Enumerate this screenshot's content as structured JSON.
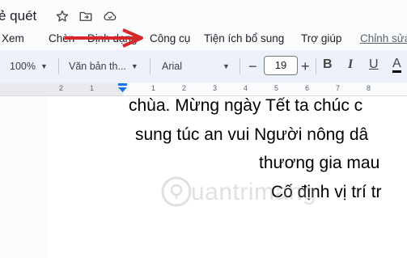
{
  "title_bar": {
    "doc_title": "ẻ quét",
    "icons": [
      "star-icon",
      "move-to-folder-icon",
      "cloud-status-icon"
    ]
  },
  "menu": {
    "items": [
      "Xem",
      "Chèn",
      "Định dạng",
      "Công cụ",
      "Tiện ích bổ sung",
      "Trợ giúp",
      "Chỉnh sửa"
    ]
  },
  "toolbar": {
    "zoom": "100%",
    "style": "Văn bản th...",
    "font": "Arial",
    "minus": "−",
    "font_size": "19",
    "plus": "+",
    "bold": "B",
    "italic": "I",
    "underline": "U",
    "text_color": "A"
  },
  "ruler": {
    "labels": [
      "2",
      "1",
      "1",
      "2",
      "3",
      "4",
      "5",
      "6",
      "7",
      "8"
    ]
  },
  "document": {
    "lines": [
      "chùa. Mừng ngày Tết ta chúc c",
      "sung túc an vui Người nông dâ",
      "thương gia mau",
      "Cố định vị trí tr"
    ]
  },
  "watermark": "uantrimang",
  "colors": {
    "arrow": "#d62828",
    "ruler_marker": "#1a73e8",
    "toolbar_bg": "#edf2fa"
  }
}
